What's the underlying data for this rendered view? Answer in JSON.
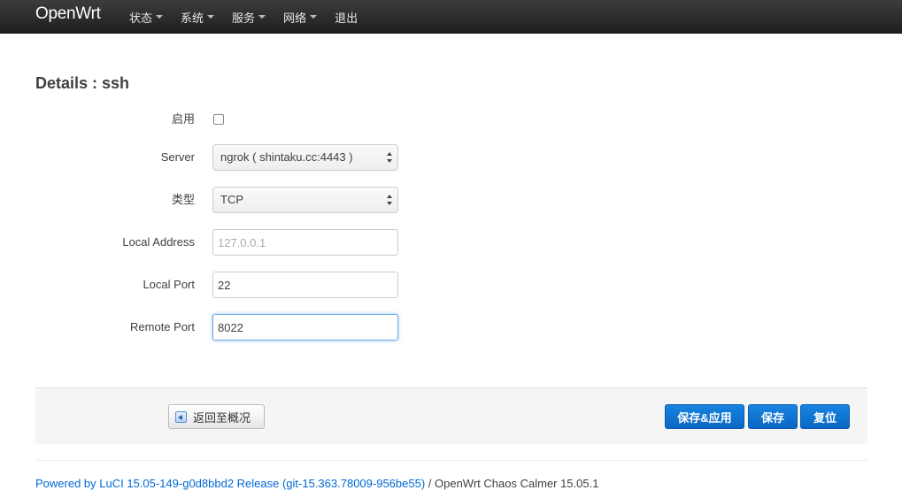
{
  "header": {
    "brand": "OpenWrt",
    "menu": [
      {
        "label": "状态"
      },
      {
        "label": "系统"
      },
      {
        "label": "服务"
      },
      {
        "label": "网络"
      },
      {
        "label": "退出"
      }
    ]
  },
  "page": {
    "title": "Details : ssh"
  },
  "form": {
    "enable": {
      "label": "启用",
      "checked": false
    },
    "server": {
      "label": "Server",
      "value": "ngrok ( shintaku.cc:4443 )"
    },
    "type": {
      "label": "类型",
      "value": "TCP"
    },
    "local_address": {
      "label": "Local Address",
      "value": "",
      "placeholder": "127.0.0.1"
    },
    "local_port": {
      "label": "Local Port",
      "value": "22"
    },
    "remote_port": {
      "label": "Remote Port",
      "value": "8022"
    }
  },
  "actions": {
    "back_label": "返回至概况",
    "save_apply_label": "保存&应用",
    "save_label": "保存",
    "reset_label": "复位"
  },
  "footer": {
    "luci_link": "Powered by LuCI 15.05-149-g0d8bbd2 Release (git-15.363.78009-956be55)",
    "rest": " / OpenWrt Chaos Calmer 15.05.1"
  },
  "colors": {
    "navbar": "#222222",
    "primary": "#0a66c4",
    "link": "#0069d6"
  }
}
